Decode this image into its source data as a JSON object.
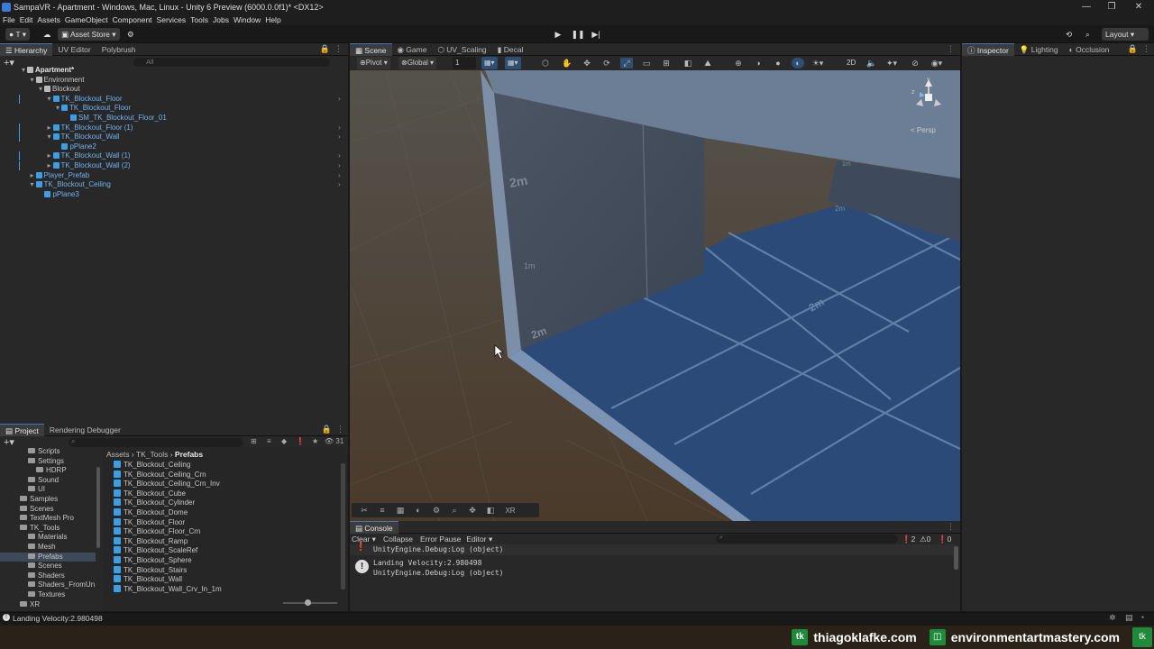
{
  "window": {
    "title": "SampaVR - Apartment - Windows, Mac, Linux - Unity 6 Preview (6000.0.0f1)* <DX12>"
  },
  "menu": [
    "File",
    "Edit",
    "Assets",
    "GameObject",
    "Component",
    "Services",
    "Tools",
    "Jobs",
    "Window",
    "Help"
  ],
  "toolbar": {
    "account": "T",
    "asset_store": "Asset Store",
    "layout": "Layout"
  },
  "hierarchy": {
    "tabs": [
      "Hierarchy",
      "UV Editor",
      "Polybrush"
    ],
    "search_placeholder": "All",
    "items": [
      {
        "label": "Apartment*",
        "depth": 0,
        "kind": "scene"
      },
      {
        "label": "Environment",
        "depth": 1,
        "kind": "plain"
      },
      {
        "label": "Blockout",
        "depth": 2,
        "kind": "plain"
      },
      {
        "label": "TK_Blockout_Floor",
        "depth": 3,
        "kind": "prefab"
      },
      {
        "label": "TK_Blockout_Floor",
        "depth": 4,
        "kind": "prefab"
      },
      {
        "label": "SM_TK_Blockout_Floor_01",
        "depth": 5,
        "kind": "prefab"
      },
      {
        "label": "TK_Blockout_Floor (1)",
        "depth": 3,
        "kind": "prefab"
      },
      {
        "label": "TK_Blockout_Wall",
        "depth": 3,
        "kind": "prefab"
      },
      {
        "label": "pPlane2",
        "depth": 4,
        "kind": "prefab"
      },
      {
        "label": "TK_Blockout_Wall (1)",
        "depth": 3,
        "kind": "prefab"
      },
      {
        "label": "TK_Blockout_Wall (2)",
        "depth": 3,
        "kind": "prefab"
      },
      {
        "label": "Player_Prefab",
        "depth": 1,
        "kind": "prefab"
      },
      {
        "label": "TK_Blockout_Ceiling",
        "depth": 1,
        "kind": "prefab"
      },
      {
        "label": "pPlane3",
        "depth": 2,
        "kind": "prefab"
      }
    ]
  },
  "scene_view": {
    "tabs": [
      "Scene",
      "Game",
      "UV_Scaling",
      "Decal"
    ],
    "pivot": "Pivot",
    "global": "Global",
    "snap_value": "1",
    "mode_2d": "2D",
    "persp": "Persp",
    "axis_y": "y",
    "axis_z": "z",
    "xr": "XR",
    "scale_labels": [
      "2m",
      "1m",
      "2m",
      "1m",
      "2m",
      "2m"
    ]
  },
  "inspector": {
    "tabs": [
      "Inspector",
      "Lighting",
      "Occlusion"
    ]
  },
  "project": {
    "tabs": [
      "Project",
      "Rendering Debugger"
    ],
    "hidden_count": "31",
    "breadcrumb": [
      "Assets",
      "TK_Tools",
      "Prefabs"
    ],
    "folders": [
      {
        "label": "Scripts",
        "depth": 1
      },
      {
        "label": "Settings",
        "depth": 1
      },
      {
        "label": "HDRP",
        "depth": 2
      },
      {
        "label": "Sound",
        "depth": 1
      },
      {
        "label": "UI",
        "depth": 1
      },
      {
        "label": "Samples",
        "depth": 0
      },
      {
        "label": "Scenes",
        "depth": 0
      },
      {
        "label": "TextMesh Pro",
        "depth": 0
      },
      {
        "label": "TK_Tools",
        "depth": 0
      },
      {
        "label": "Materials",
        "depth": 1
      },
      {
        "label": "Mesh",
        "depth": 1
      },
      {
        "label": "Prefabs",
        "depth": 1,
        "selected": true
      },
      {
        "label": "Scenes",
        "depth": 1
      },
      {
        "label": "Shaders",
        "depth": 1
      },
      {
        "label": "Shaders_FromUn",
        "depth": 1
      },
      {
        "label": "Textures",
        "depth": 1
      },
      {
        "label": "XR",
        "depth": 0
      }
    ],
    "assets": [
      "TK_Blockout_Ceiling",
      "TK_Blockout_Ceiling_Crn",
      "TK_Blockout_Ceiling_Crn_Inv",
      "TK_Blockout_Cube",
      "TK_Blockout_Cylinder",
      "TK_Blockout_Dome",
      "TK_Blockout_Floor",
      "TK_Blockout_Floor_Crn",
      "TK_Blockout_Ramp",
      "TK_Blockout_ScaleRef",
      "TK_Blockout_Sphere",
      "TK_Blockout_Stairs",
      "TK_Blockout_Wall",
      "TK_Blockout_Wall_Crv_In_1m"
    ]
  },
  "console": {
    "tab": "Console",
    "buttons": {
      "clear": "Clear",
      "collapse": "Collapse",
      "error_pause": "Error Pause",
      "editor": "Editor"
    },
    "counts": {
      "log": "2",
      "warn": "0",
      "error": "0"
    },
    "logs": [
      {
        "line1": "UnityEngine.Debug:Log (object)",
        "line2": ""
      },
      {
        "line1": "Landing Velocity:2.980498",
        "line2": "UnityEngine.Debug:Log (object)"
      }
    ]
  },
  "status_bar": {
    "text": "Landing Velocity:2.980498"
  },
  "watermark": {
    "site1": "thiagoklafke.com",
    "site2": "environmentartmastery.com",
    "tk": "tk"
  },
  "colors": {
    "accent": "#3a79bb",
    "prefab_text": "#6fb3f0",
    "panel": "#282828",
    "scene_floor": "#2b4a77",
    "scene_ground": "#4a4038"
  }
}
